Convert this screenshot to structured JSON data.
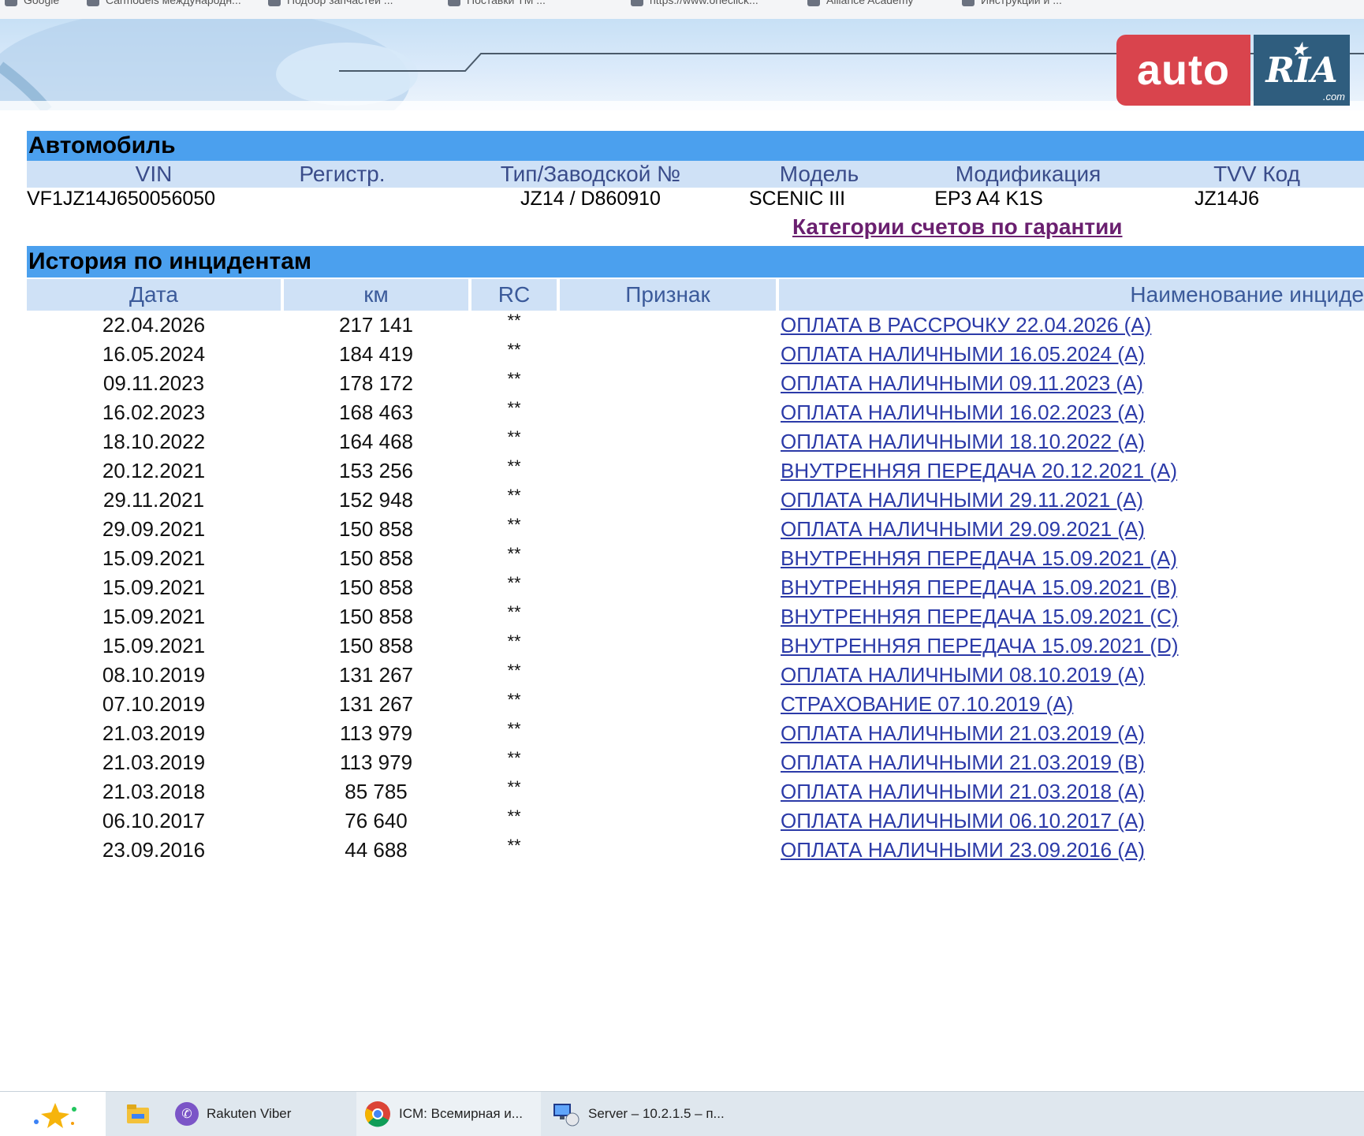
{
  "bookmarks": [
    "Google",
    "Carmodels международн...",
    "Подбор запчастей ...",
    "Поставки ТМ ...",
    "https://www.oneclick...",
    "Alliance Academy",
    "Инструкции и ..."
  ],
  "logo": {
    "left": "auto",
    "right": "RIA",
    "suffix": ".com"
  },
  "vehicle": {
    "section_title": "Автомобиль",
    "columns": [
      "VIN",
      "Регистр.",
      "Тип/Заводской №",
      "Модель",
      "Модификация",
      "TVV Код"
    ],
    "values": [
      "VF1JZ14J650056050",
      "",
      "JZ14 / D860910",
      "SCENIC III",
      "EP3 A4 K1S",
      "JZ14J6"
    ],
    "warranty_link": "Категории счетов по гарантии"
  },
  "incidents": {
    "section_title": "История по инцидентам",
    "columns": [
      "Дата",
      "км",
      "RC",
      "Признак",
      "Наименование инциде"
    ],
    "rows": [
      {
        "date": "22.04.2026",
        "km": "217 141",
        "rc": "**",
        "flag": "",
        "name": "ОПЛАТА В РАССРОЧКУ 22.04.2026 (A)"
      },
      {
        "date": "16.05.2024",
        "km": "184 419",
        "rc": "**",
        "flag": "",
        "name": "ОПЛАТА НАЛИЧНЫМИ 16.05.2024 (A)"
      },
      {
        "date": "09.11.2023",
        "km": "178 172",
        "rc": "**",
        "flag": "",
        "name": "ОПЛАТА НАЛИЧНЫМИ 09.11.2023 (A)"
      },
      {
        "date": "16.02.2023",
        "km": "168 463",
        "rc": "**",
        "flag": "",
        "name": "ОПЛАТА НАЛИЧНЫМИ 16.02.2023 (A)"
      },
      {
        "date": "18.10.2022",
        "km": "164 468",
        "rc": "**",
        "flag": "",
        "name": "ОПЛАТА НАЛИЧНЫМИ 18.10.2022 (A)"
      },
      {
        "date": "20.12.2021",
        "km": "153 256",
        "rc": "**",
        "flag": "",
        "name": "ВНУТРЕННЯЯ ПЕРЕДАЧА 20.12.2021 (A)"
      },
      {
        "date": "29.11.2021",
        "km": "152 948",
        "rc": "**",
        "flag": "",
        "name": "ОПЛАТА НАЛИЧНЫМИ 29.11.2021 (A)"
      },
      {
        "date": "29.09.2021",
        "km": "150 858",
        "rc": "**",
        "flag": "",
        "name": "ОПЛАТА НАЛИЧНЫМИ 29.09.2021 (A)"
      },
      {
        "date": "15.09.2021",
        "km": "150 858",
        "rc": "**",
        "flag": "",
        "name": "ВНУТРЕННЯЯ ПЕРЕДАЧА 15.09.2021 (A)"
      },
      {
        "date": "15.09.2021",
        "km": "150 858",
        "rc": "**",
        "flag": "",
        "name": "ВНУТРЕННЯЯ ПЕРЕДАЧА 15.09.2021 (B)"
      },
      {
        "date": "15.09.2021",
        "km": "150 858",
        "rc": "**",
        "flag": "",
        "name": "ВНУТРЕННЯЯ ПЕРЕДАЧА 15.09.2021 (C)"
      },
      {
        "date": "15.09.2021",
        "km": "150 858",
        "rc": "**",
        "flag": "",
        "name": "ВНУТРЕННЯЯ ПЕРЕДАЧА 15.09.2021 (D)"
      },
      {
        "date": "08.10.2019",
        "km": "131 267",
        "rc": "**",
        "flag": "",
        "name": "ОПЛАТА НАЛИЧНЫМИ 08.10.2019 (A)"
      },
      {
        "date": "07.10.2019",
        "km": "131 267",
        "rc": "**",
        "flag": "",
        "name": "СТРАХОВАНИЕ 07.10.2019 (A)"
      },
      {
        "date": "21.03.2019",
        "km": "113 979",
        "rc": "**",
        "flag": "",
        "name": "ОПЛАТА НАЛИЧНЫМИ 21.03.2019 (A)"
      },
      {
        "date": "21.03.2019",
        "km": "113 979",
        "rc": "**",
        "flag": "",
        "name": "ОПЛАТА НАЛИЧНЫМИ 21.03.2019 (B)"
      },
      {
        "date": "21.03.2018",
        "km": "85 785",
        "rc": "**",
        "flag": "",
        "name": "ОПЛАТА НАЛИЧНЫМИ 21.03.2018 (A)"
      },
      {
        "date": "06.10.2017",
        "km": "76 640",
        "rc": "**",
        "flag": "",
        "name": "ОПЛАТА НАЛИЧНЫМИ 06.10.2017 (A)"
      },
      {
        "date": "23.09.2016",
        "km": "44 688",
        "rc": "**",
        "flag": "",
        "name": "ОПЛАТА НАЛИЧНЫМИ 23.09.2016 (A)"
      }
    ]
  },
  "taskbar": {
    "items": [
      {
        "icon": "sparkle-icon",
        "label": ""
      },
      {
        "icon": "file-explorer-icon",
        "label": ""
      },
      {
        "icon": "viber-icon",
        "label": "Rakuten Viber"
      },
      {
        "icon": "chrome-icon",
        "label": "ICM: Всемирная и..."
      },
      {
        "icon": "remote-desktop-icon",
        "label": "Server – 10.2.1.5 – п..."
      }
    ]
  },
  "colors": {
    "section_header": "#4ba0ee",
    "column_header": "#cfe1f6",
    "link": "#2b3aa8",
    "visited_link": "#6a1f6f",
    "logo_red": "#d9444d",
    "logo_blue": "#2f5d7e"
  }
}
